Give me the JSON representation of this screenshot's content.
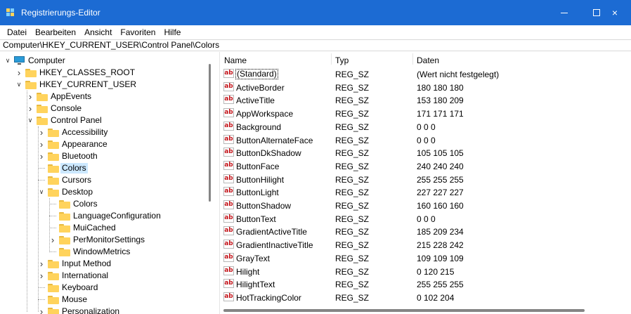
{
  "window": {
    "title": "Registrierungs-Editor",
    "icon": "registry-editor-icon",
    "controls": {
      "minimize": "minimize-icon",
      "maximize": "maximize-icon",
      "close": "×"
    }
  },
  "menu": [
    "Datei",
    "Bearbeiten",
    "Ansicht",
    "Favoriten",
    "Hilfe"
  ],
  "address": "Computer\\HKEY_CURRENT_USER\\Control Panel\\Colors",
  "tree": [
    {
      "label": "Computer",
      "icon": "computer-icon",
      "expander": "expanded"
    },
    {
      "label": "HKEY_CLASSES_ROOT",
      "icon": "folder-icon",
      "expander": "collapsed"
    },
    {
      "label": "HKEY_CURRENT_USER",
      "icon": "folder-icon",
      "expander": "expanded"
    },
    {
      "label": "AppEvents",
      "icon": "folder-icon",
      "expander": "collapsed"
    },
    {
      "label": "Console",
      "icon": "folder-icon",
      "expander": "collapsed"
    },
    {
      "label": "Control Panel",
      "icon": "folder-icon",
      "expander": "expanded"
    },
    {
      "label": "Accessibility",
      "icon": "folder-icon",
      "expander": "collapsed"
    },
    {
      "label": "Appearance",
      "icon": "folder-icon",
      "expander": "collapsed"
    },
    {
      "label": "Bluetooth",
      "icon": "folder-icon",
      "expander": "collapsed"
    },
    {
      "label": "Colors",
      "icon": "folder-icon",
      "expander": "none",
      "selected": true
    },
    {
      "label": "Cursors",
      "icon": "folder-icon",
      "expander": "none"
    },
    {
      "label": "Desktop",
      "icon": "folder-icon",
      "expander": "expanded"
    },
    {
      "label": "Colors",
      "icon": "folder-icon",
      "expander": "none"
    },
    {
      "label": "LanguageConfiguration",
      "icon": "folder-icon",
      "expander": "none"
    },
    {
      "label": "MuiCached",
      "icon": "folder-icon",
      "expander": "none"
    },
    {
      "label": "PerMonitorSettings",
      "icon": "folder-icon",
      "expander": "collapsed"
    },
    {
      "label": "WindowMetrics",
      "icon": "folder-icon",
      "expander": "none"
    },
    {
      "label": "Input Method",
      "icon": "folder-icon",
      "expander": "collapsed"
    },
    {
      "label": "International",
      "icon": "folder-icon",
      "expander": "collapsed"
    },
    {
      "label": "Keyboard",
      "icon": "folder-icon",
      "expander": "none"
    },
    {
      "label": "Mouse",
      "icon": "folder-icon",
      "expander": "none"
    },
    {
      "label": "Personalization",
      "icon": "folder-icon",
      "expander": "collapsed"
    }
  ],
  "list": {
    "columns": {
      "name": "Name",
      "type": "Typ",
      "data": "Daten"
    },
    "value_icon_text": "ab",
    "rows": [
      {
        "name": "(Standard)",
        "type": "REG_SZ",
        "data": "(Wert nicht festgelegt)",
        "focused": true
      },
      {
        "name": "ActiveBorder",
        "type": "REG_SZ",
        "data": "180 180 180"
      },
      {
        "name": "ActiveTitle",
        "type": "REG_SZ",
        "data": "153 180 209"
      },
      {
        "name": "AppWorkspace",
        "type": "REG_SZ",
        "data": "171 171 171"
      },
      {
        "name": "Background",
        "type": "REG_SZ",
        "data": "0 0 0"
      },
      {
        "name": "ButtonAlternateFace",
        "type": "REG_SZ",
        "data": "0 0 0"
      },
      {
        "name": "ButtonDkShadow",
        "type": "REG_SZ",
        "data": "105 105 105"
      },
      {
        "name": "ButtonFace",
        "type": "REG_SZ",
        "data": "240 240 240"
      },
      {
        "name": "ButtonHilight",
        "type": "REG_SZ",
        "data": "255 255 255"
      },
      {
        "name": "ButtonLight",
        "type": "REG_SZ",
        "data": "227 227 227"
      },
      {
        "name": "ButtonShadow",
        "type": "REG_SZ",
        "data": "160 160 160"
      },
      {
        "name": "ButtonText",
        "type": "REG_SZ",
        "data": "0 0 0"
      },
      {
        "name": "GradientActiveTitle",
        "type": "REG_SZ",
        "data": "185 209 234"
      },
      {
        "name": "GradientInactiveTitle",
        "type": "REG_SZ",
        "data": "215 228 242"
      },
      {
        "name": "GrayText",
        "type": "REG_SZ",
        "data": "109 109 109"
      },
      {
        "name": "Hilight",
        "type": "REG_SZ",
        "data": "0 120 215"
      },
      {
        "name": "HilightText",
        "type": "REG_SZ",
        "data": "255 255 255"
      },
      {
        "name": "HotTrackingColor",
        "type": "REG_SZ",
        "data": "0 102 204"
      }
    ]
  },
  "colors": {
    "titlebar": "#1c6bd3",
    "selection": "#cce8ff",
    "folder": "#ffd35c",
    "value_icon": "#c4161c"
  }
}
